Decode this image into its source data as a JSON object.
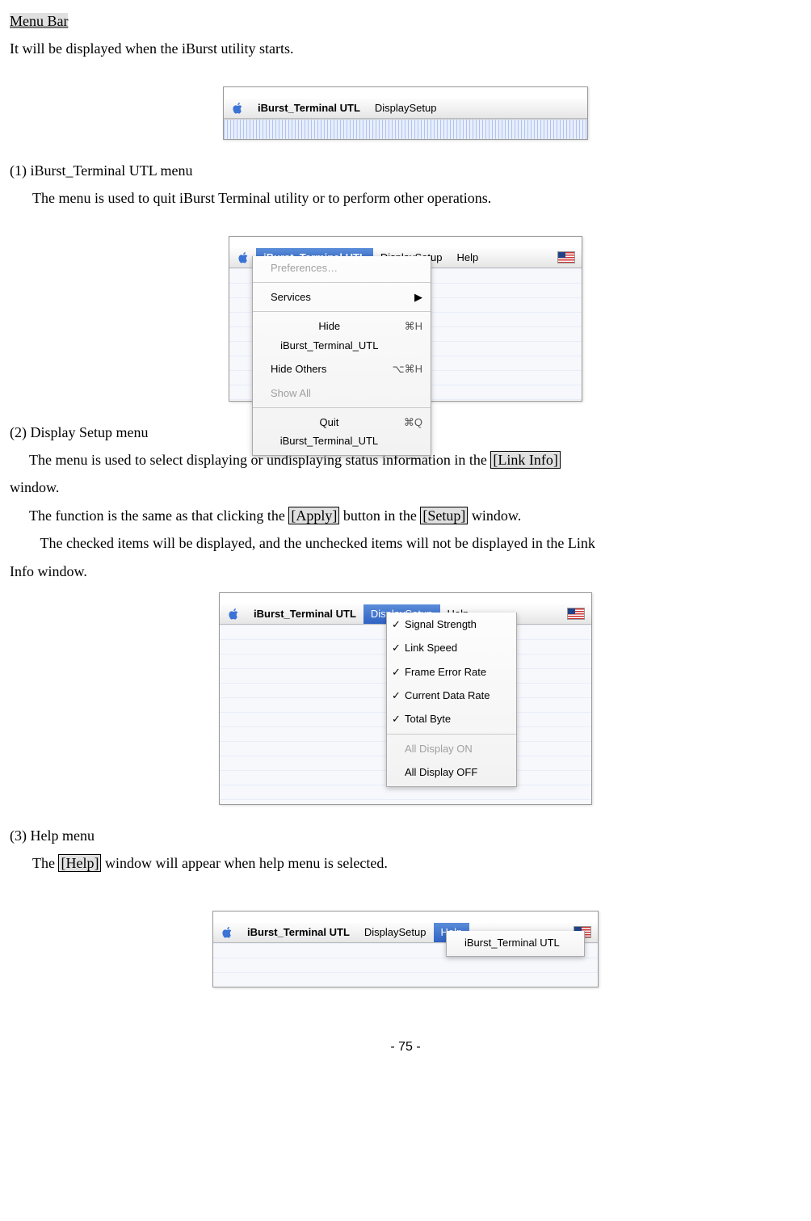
{
  "header": {
    "title": "Menu Bar",
    "subtitle": "It will be displayed when the iBurst utility starts."
  },
  "menubar_common": {
    "app": "iBurst_Terminal UTL",
    "display": "DisplaySetup",
    "help": "Help"
  },
  "section1": {
    "num": "(1)",
    "title_rest": " iBurst_Terminal UTL menu",
    "body": "The menu is used to quit iBurst Terminal utility or to perform other operations."
  },
  "shot2_menu": {
    "items": [
      {
        "label": "Preferences…",
        "disabled": true
      },
      {
        "sep": true
      },
      {
        "label": "Services",
        "sub": true
      },
      {
        "sep": true
      },
      {
        "label": "Hide iBurst_Terminal_UTL",
        "shortcut": "⌘H"
      },
      {
        "label": "Hide Others",
        "shortcut": "⌥⌘H"
      },
      {
        "label": "Show All",
        "disabled": true
      },
      {
        "sep": true
      },
      {
        "label": "Quit iBurst_Terminal_UTL",
        "shortcut": "⌘Q"
      }
    ]
  },
  "section2": {
    "num_title": "(2) Display Setup menu",
    "p1a": "The menu is used to select displaying or undisplaying status information in the ",
    "p1_link": "[Link Info]",
    "p1b": " window.",
    "p2a": "The function is the same as that clicking the ",
    "p2_apply": "[Apply]",
    "p2b": " button in the ",
    "p2_setup": "[Setup]",
    "p2c": " window.",
    "p3": "The checked items will be displayed, and the unchecked items will not be displayed in the Link Info window."
  },
  "shot3_menu": {
    "items": [
      {
        "label": "Signal Strength",
        "checked": true
      },
      {
        "label": "Link Speed",
        "checked": true
      },
      {
        "label": "Frame Error Rate",
        "checked": true
      },
      {
        "label": "Current Data Rate",
        "checked": true
      },
      {
        "label": "Total Byte",
        "checked": true
      },
      {
        "sep": true
      },
      {
        "label": "All Display ON",
        "disabled": true
      },
      {
        "label": "All Display OFF"
      }
    ]
  },
  "section3": {
    "num_title": "(3) Help menu",
    "p1a": "The ",
    "p1_help": "[Help]",
    "p1b": " window will appear when help menu is selected."
  },
  "shot4_menu": {
    "items": [
      {
        "label": "iBurst_Terminal UTL"
      }
    ]
  },
  "page_number": "- 75 -"
}
